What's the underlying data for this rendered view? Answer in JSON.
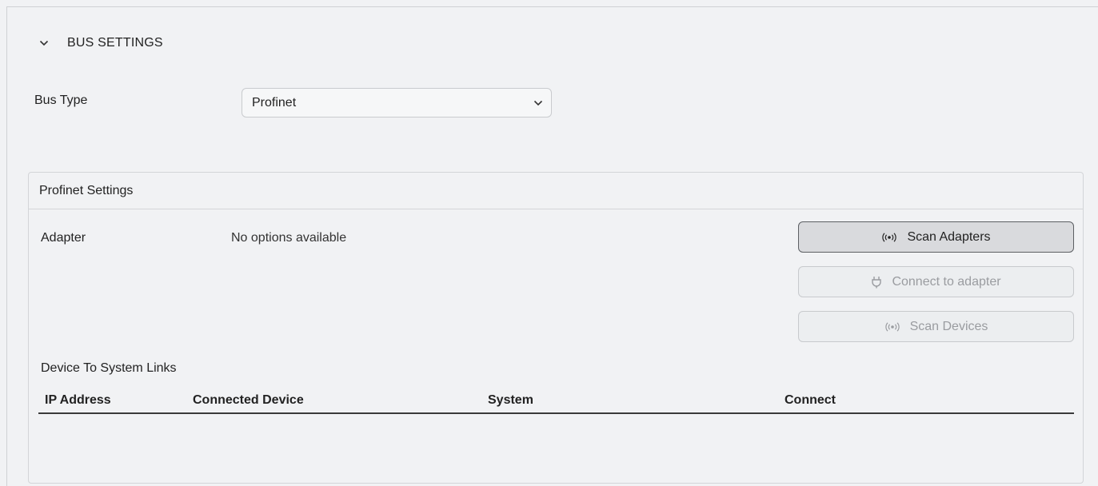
{
  "section": {
    "title": "BUS SETTINGS",
    "icon": "chevron-down-icon"
  },
  "bus_type": {
    "label": "Bus Type",
    "selected": "Profinet",
    "icon": "chevron-down-icon"
  },
  "profinet": {
    "title": "Profinet Settings",
    "adapter_label": "Adapter",
    "adapter_value": "No options available",
    "buttons": {
      "scan_adapters": {
        "label": "Scan Adapters",
        "icon": "broadcast-icon",
        "enabled": true
      },
      "connect_adapter": {
        "label": "Connect to adapter",
        "icon": "plug-icon",
        "enabled": false
      },
      "scan_devices": {
        "label": "Scan Devices",
        "icon": "broadcast-icon",
        "enabled": false
      }
    },
    "links_title": "Device To System Links",
    "table": {
      "columns": [
        "IP Address",
        "Connected Device",
        "System",
        "Connect"
      ],
      "rows": []
    }
  },
  "colors": {
    "background": "#f1f2f4",
    "border": "#d3d5d8",
    "disabled_text": "#9a9ca0",
    "primary_button_border": "#5c5f63"
  }
}
